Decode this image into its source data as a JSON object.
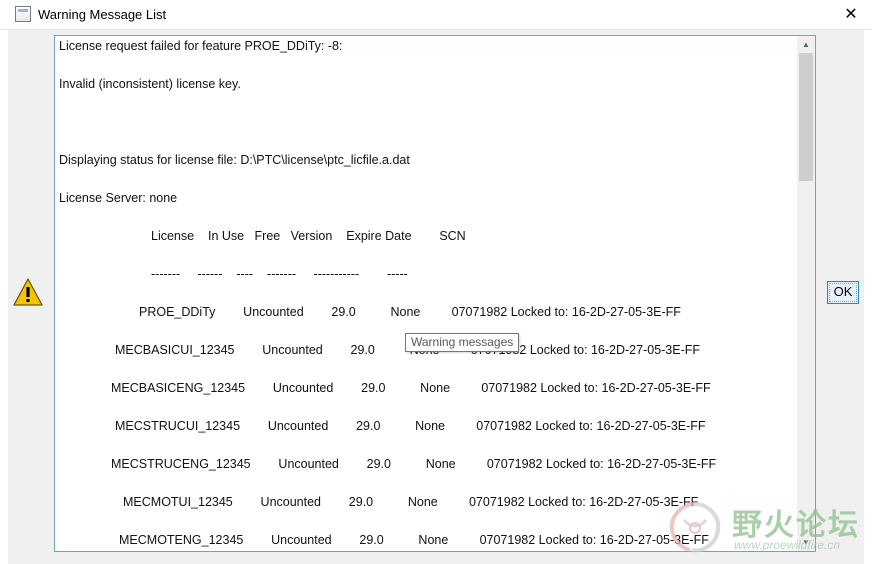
{
  "window": {
    "title": "Warning Message List",
    "close_glyph": "✕",
    "icon": "window-icon"
  },
  "messages": {
    "header_lines": [
      "License request failed for feature PROE_DDiTy: -8:",
      "Invalid (inconsistent) license key.",
      "Displaying status for license file: D:\\PTC\\license\\ptc_licfile.a.dat",
      "License Server: none"
    ],
    "table_header": "License    In Use   Free   Version    Expire Date        SCN",
    "table_divider": "-------     ------    ----    -------     -----------        -----",
    "rows": [
      "PROE_DDiTy        Uncounted        29.0          None         07071982 Locked to: 16-2D-27-05-3E-FF",
      "MECBASICUI_12345        Uncounted        29.0          None         07071982 Locked to: 16-2D-27-05-3E-FF",
      "MECBASICENG_12345        Uncounted        29.0          None         07071982 Locked to: 16-2D-27-05-3E-FF",
      "MECSTRUCUI_12345        Uncounted        29.0          None         07071982 Locked to: 16-2D-27-05-3E-FF",
      "MECSTRUCENG_12345        Uncounted        29.0          None         07071982 Locked to: 16-2D-27-05-3E-FF",
      "MECMOTUI_12345        Uncounted        29.0          None         07071982 Locked to: 16-2D-27-05-3E-FF",
      "MECMOTENG_12345        Uncounted        29.0          None         07071982 Locked to: 16-2D-27-05-3E-FF"
    ]
  },
  "buttons": {
    "ok_label": "OK"
  },
  "tooltip": {
    "text": "Warning messages"
  },
  "scrollbar": {
    "up_glyph": "▲",
    "down_glyph": "▼"
  },
  "watermark": {
    "text": "野火论坛",
    "url": "www.proewildfire.cn"
  },
  "icons": {
    "warning": "warning-triangle-icon"
  },
  "colors": {
    "frame_border": "#7a9ebf",
    "ok_border": "#2f7fd5",
    "warning_fill": "#f5c400",
    "dialog_bg": "#f0f0f0"
  }
}
